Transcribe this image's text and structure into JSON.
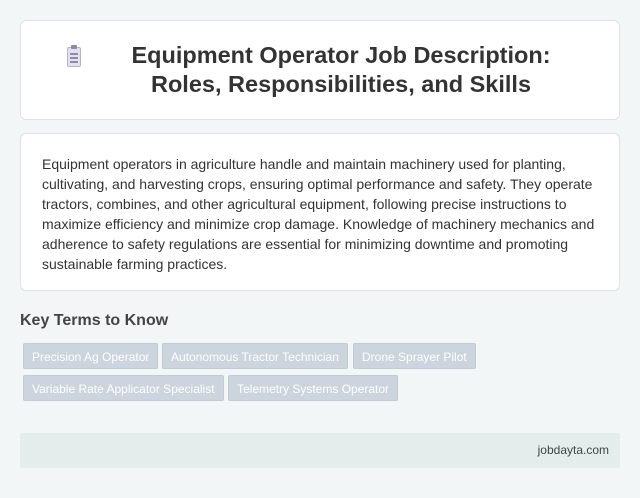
{
  "header": {
    "icon": "document-icon",
    "title": "Equipment Operator Job Description: Roles, Responsibilities, and Skills"
  },
  "description": {
    "text": "Equipment operators in agriculture handle and maintain machinery used for planting, cultivating, and harvesting crops, ensuring optimal performance and safety. They operate tractors, combines, and other agricultural equipment, following precise instructions to maximize efficiency and minimize crop damage. Knowledge of machinery mechanics and adherence to safety regulations are essential for minimizing downtime and promoting sustainable farming practices."
  },
  "key_terms": {
    "heading": "Key Terms to Know",
    "tags": [
      "Precision Ag Operator",
      "Autonomous Tractor Technician",
      "Drone Sprayer Pilot",
      "Variable Rate Applicator Specialist",
      "Telemetry Systems Operator"
    ]
  },
  "footer": {
    "site": "jobdayta.com"
  }
}
